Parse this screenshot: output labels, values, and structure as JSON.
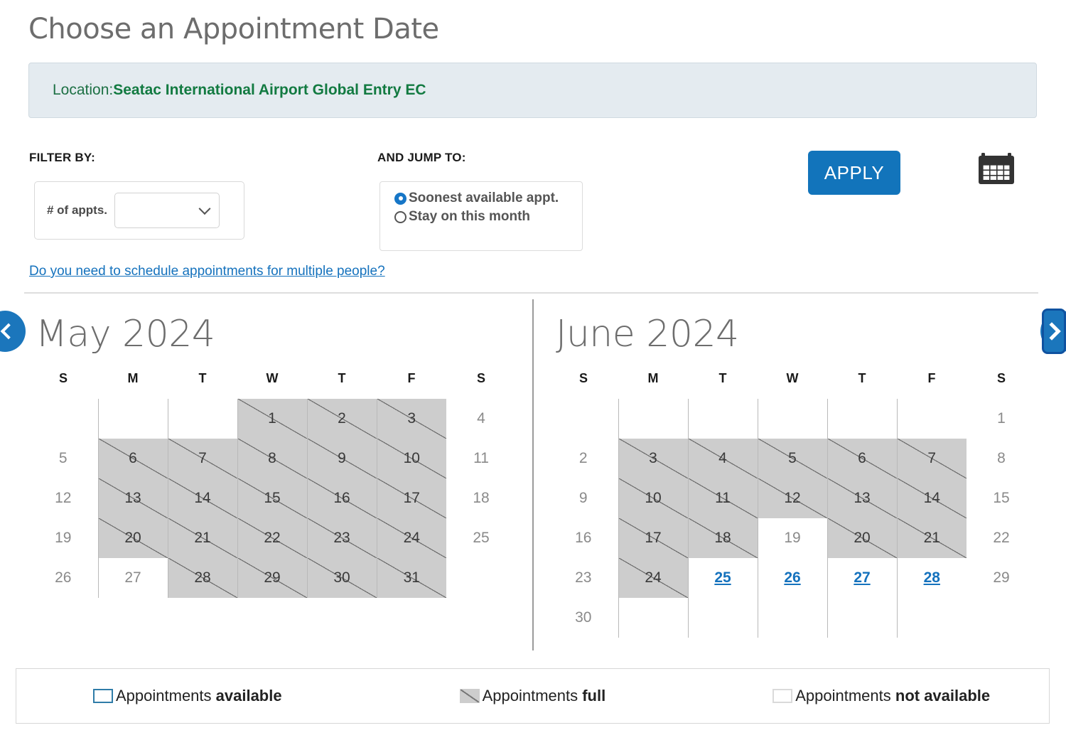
{
  "page_title": "Choose an Appointment Date",
  "location": {
    "label": "Location:",
    "value": "Seatac International Airport Global Entry EC"
  },
  "filter": {
    "heading": "FILTER BY:",
    "appts_label": "# of appts.",
    "select_value": "",
    "select_icon": "chevron-down-icon"
  },
  "jump": {
    "heading": "AND JUMP TO:",
    "options": [
      {
        "label": "Soonest available appt.",
        "selected": true
      },
      {
        "label": "Stay on this month",
        "selected": false
      }
    ]
  },
  "multi_people_link": "Do you need to schedule appointments for multiple people?",
  "apply_button": "APPLY",
  "calendar_icon": "calendar-icon",
  "nav": {
    "prev_icon": "chevron-left-icon",
    "next_icon": "chevron-right-icon"
  },
  "weekday_headers": [
    "S",
    "M",
    "T",
    "W",
    "T",
    "F",
    "S"
  ],
  "calendars": [
    {
      "title": "May 2024",
      "weeks": [
        [
          {
            "day": "",
            "state": "blank"
          },
          {
            "day": "",
            "state": "blank"
          },
          {
            "day": "",
            "state": "blank"
          },
          {
            "day": "1",
            "state": "full"
          },
          {
            "day": "2",
            "state": "full"
          },
          {
            "day": "3",
            "state": "full"
          },
          {
            "day": "4",
            "state": "weekend"
          }
        ],
        [
          {
            "day": "5",
            "state": "weekend"
          },
          {
            "day": "6",
            "state": "full"
          },
          {
            "day": "7",
            "state": "full"
          },
          {
            "day": "8",
            "state": "full"
          },
          {
            "day": "9",
            "state": "full"
          },
          {
            "day": "10",
            "state": "full"
          },
          {
            "day": "11",
            "state": "weekend"
          }
        ],
        [
          {
            "day": "12",
            "state": "weekend"
          },
          {
            "day": "13",
            "state": "full"
          },
          {
            "day": "14",
            "state": "full"
          },
          {
            "day": "15",
            "state": "full"
          },
          {
            "day": "16",
            "state": "full"
          },
          {
            "day": "17",
            "state": "full"
          },
          {
            "day": "18",
            "state": "weekend"
          }
        ],
        [
          {
            "day": "19",
            "state": "weekend"
          },
          {
            "day": "20",
            "state": "full"
          },
          {
            "day": "21",
            "state": "full"
          },
          {
            "day": "22",
            "state": "full"
          },
          {
            "day": "23",
            "state": "full"
          },
          {
            "day": "24",
            "state": "full"
          },
          {
            "day": "25",
            "state": "weekend"
          }
        ],
        [
          {
            "day": "26",
            "state": "weekend"
          },
          {
            "day": "27",
            "state": "notavailable"
          },
          {
            "day": "28",
            "state": "full"
          },
          {
            "day": "29",
            "state": "full"
          },
          {
            "day": "30",
            "state": "full"
          },
          {
            "day": "31",
            "state": "full"
          },
          {
            "day": "",
            "state": "blank"
          }
        ]
      ]
    },
    {
      "title": "June 2024",
      "weeks": [
        [
          {
            "day": "",
            "state": "blank"
          },
          {
            "day": "",
            "state": "notavailable"
          },
          {
            "day": "",
            "state": "notavailable"
          },
          {
            "day": "",
            "state": "notavailable"
          },
          {
            "day": "",
            "state": "notavailable"
          },
          {
            "day": "",
            "state": "notavailable"
          },
          {
            "day": "1",
            "state": "weekend"
          }
        ],
        [
          {
            "day": "2",
            "state": "weekend"
          },
          {
            "day": "3",
            "state": "full"
          },
          {
            "day": "4",
            "state": "full"
          },
          {
            "day": "5",
            "state": "full"
          },
          {
            "day": "6",
            "state": "full"
          },
          {
            "day": "7",
            "state": "full"
          },
          {
            "day": "8",
            "state": "weekend"
          }
        ],
        [
          {
            "day": "9",
            "state": "weekend"
          },
          {
            "day": "10",
            "state": "full"
          },
          {
            "day": "11",
            "state": "full"
          },
          {
            "day": "12",
            "state": "full"
          },
          {
            "day": "13",
            "state": "full"
          },
          {
            "day": "14",
            "state": "full"
          },
          {
            "day": "15",
            "state": "weekend"
          }
        ],
        [
          {
            "day": "16",
            "state": "weekend"
          },
          {
            "day": "17",
            "state": "full"
          },
          {
            "day": "18",
            "state": "full"
          },
          {
            "day": "19",
            "state": "notavailable"
          },
          {
            "day": "20",
            "state": "full"
          },
          {
            "day": "21",
            "state": "full"
          },
          {
            "day": "22",
            "state": "weekend"
          }
        ],
        [
          {
            "day": "23",
            "state": "weekend"
          },
          {
            "day": "24",
            "state": "full"
          },
          {
            "day": "25",
            "state": "avail"
          },
          {
            "day": "26",
            "state": "avail"
          },
          {
            "day": "27",
            "state": "avail"
          },
          {
            "day": "28",
            "state": "avail"
          },
          {
            "day": "29",
            "state": "weekend"
          }
        ],
        [
          {
            "day": "30",
            "state": "weekend"
          },
          {
            "day": "",
            "state": "notavailable"
          },
          {
            "day": "",
            "state": "notavailable"
          },
          {
            "day": "",
            "state": "notavailable"
          },
          {
            "day": "",
            "state": "notavailable"
          },
          {
            "day": "",
            "state": "notavailable"
          },
          {
            "day": "",
            "state": "blank"
          }
        ]
      ]
    }
  ],
  "legend": [
    {
      "swatch": "available",
      "prefix": "Appointments ",
      "emphasis": "available"
    },
    {
      "swatch": "full",
      "prefix": "Appointments ",
      "emphasis": "full"
    },
    {
      "swatch": "notavailable",
      "prefix": "Appointments ",
      "emphasis": "not available"
    }
  ],
  "colors": {
    "accent_blue": "#1274bb",
    "link_blue": "#1572bd",
    "location_green": "#127a41",
    "banner_bg": "#e4ebf0",
    "full_gray": "#cdcdcd"
  }
}
